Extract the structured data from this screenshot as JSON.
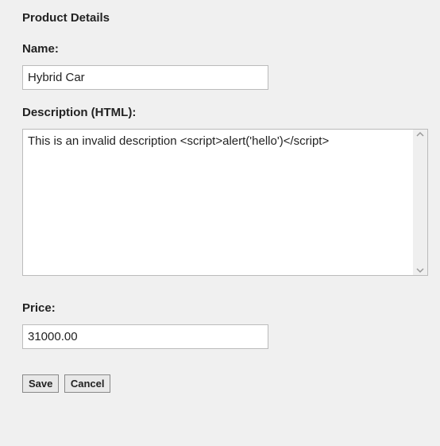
{
  "section": {
    "title": "Product Details"
  },
  "fields": {
    "name": {
      "label": "Name:",
      "value": "Hybrid Car"
    },
    "description": {
      "label": "Description (HTML):",
      "value": "This is an invalid description <script>alert('hello')</script>"
    },
    "price": {
      "label": "Price:",
      "value": "31000.00"
    }
  },
  "buttons": {
    "save": "Save",
    "cancel": "Cancel"
  }
}
